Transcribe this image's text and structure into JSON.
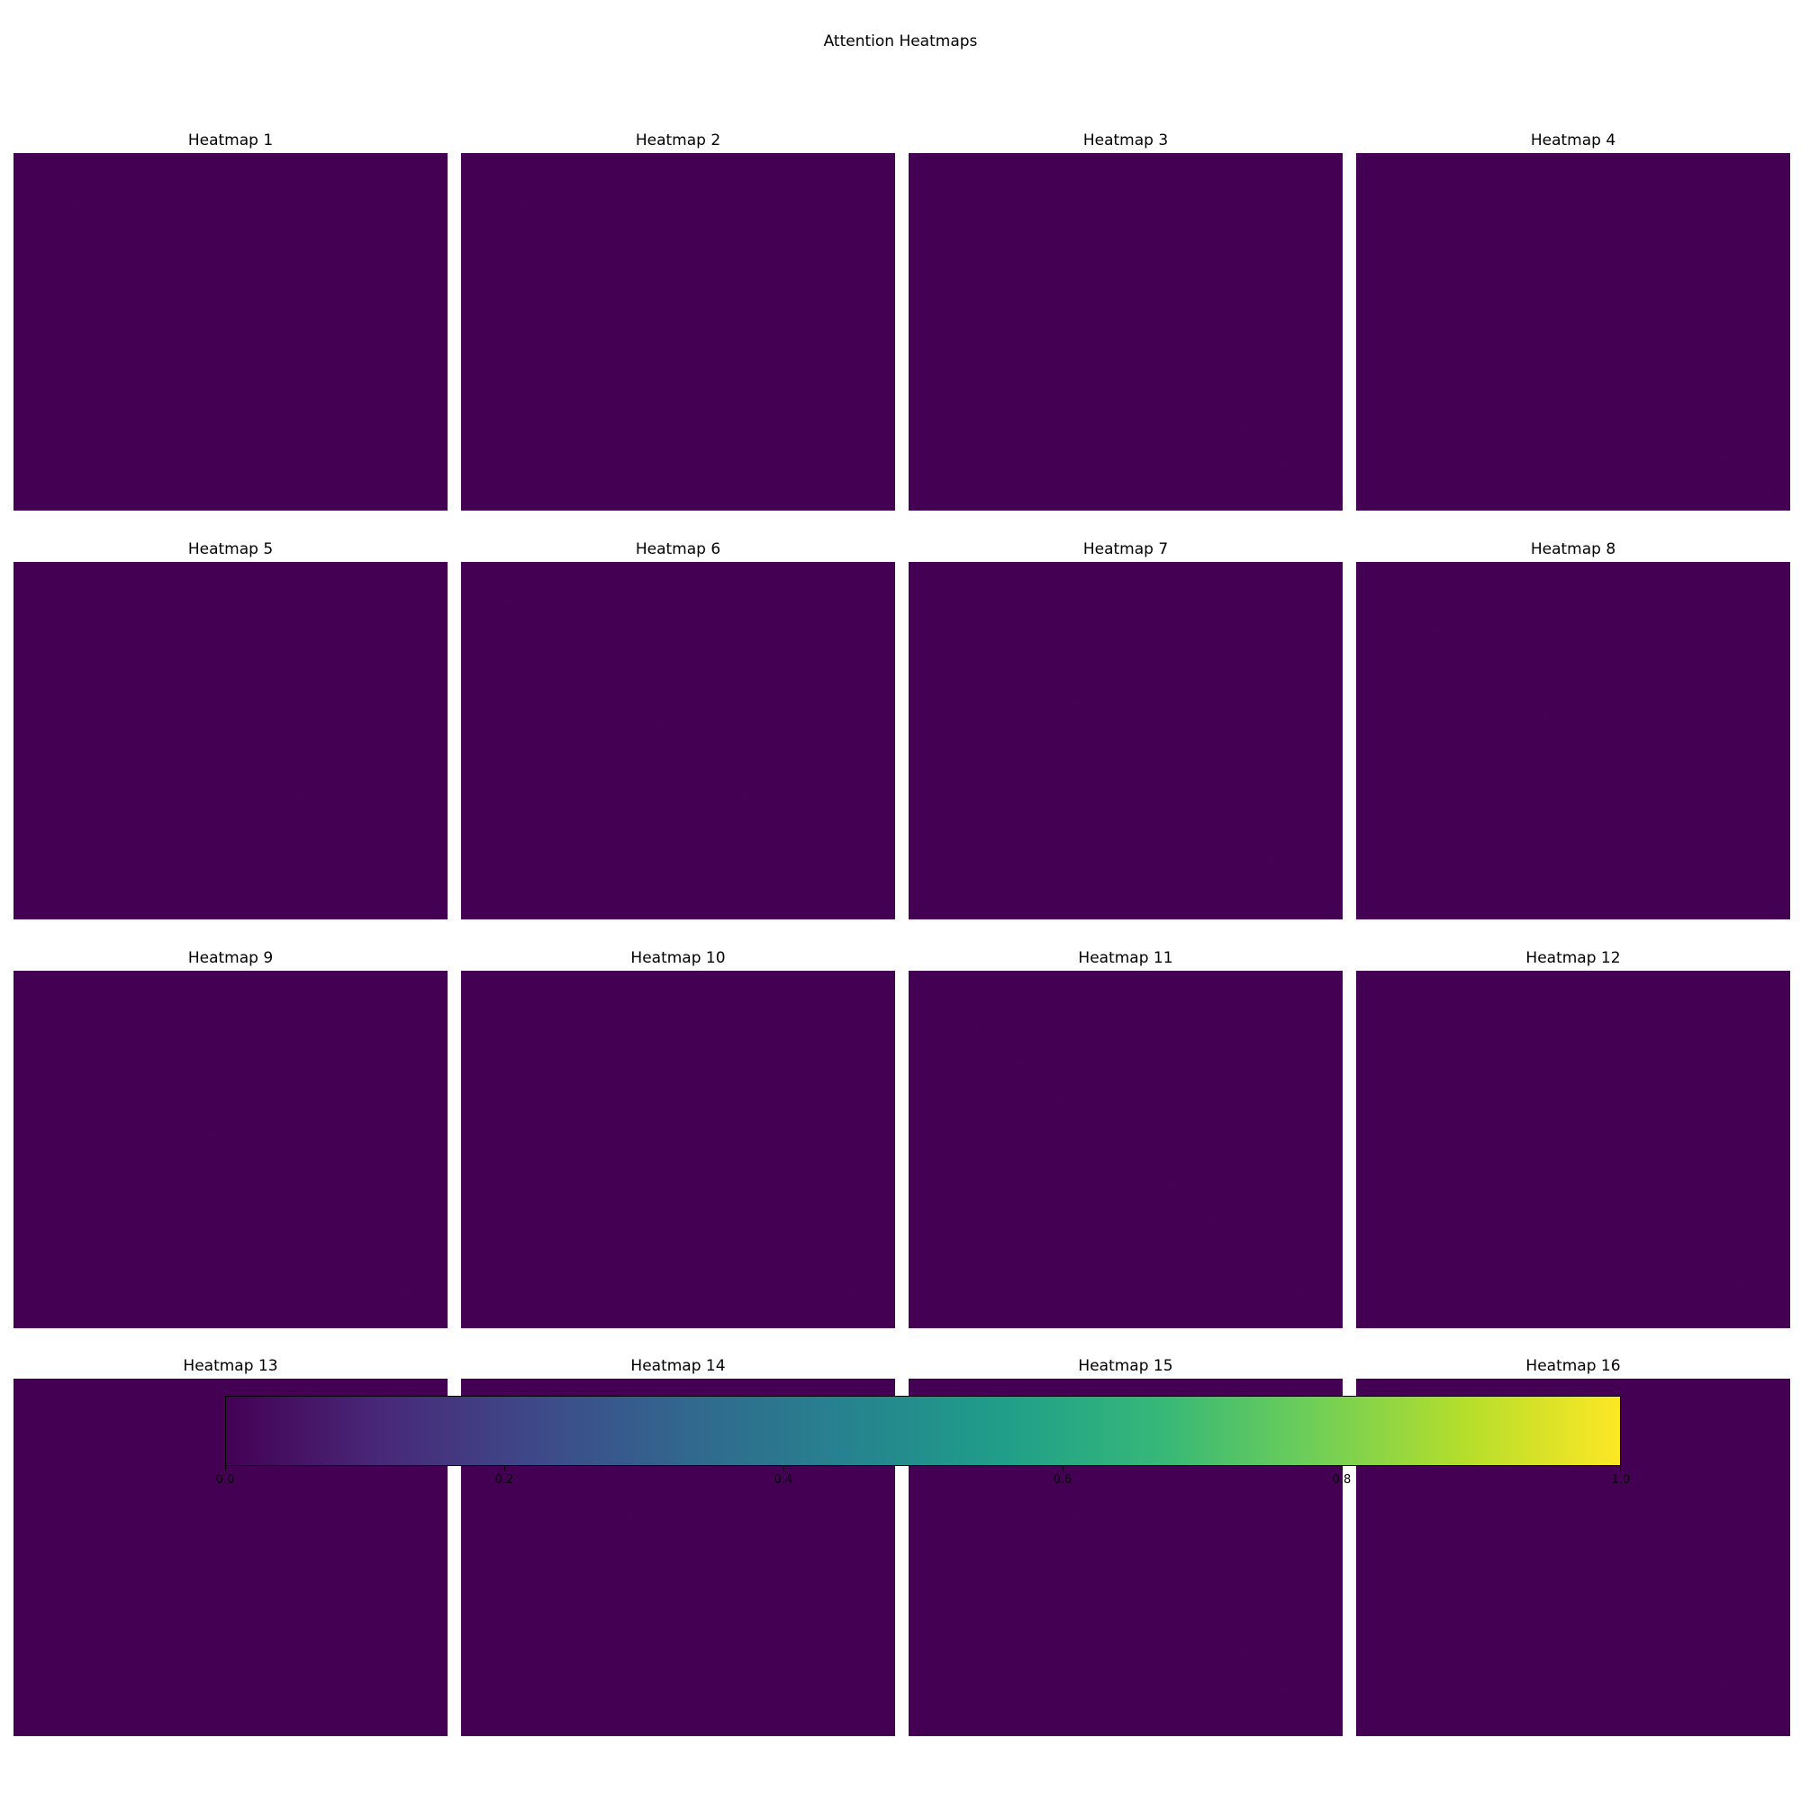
{
  "chart_data": {
    "type": "heatmap",
    "title": "Attention Heatmaps",
    "layout": {
      "rows": 4,
      "columns": 4
    },
    "axes_visible": false,
    "panels": [
      {
        "title": "Heatmap 1",
        "background_value": 0.0,
        "diagonal_value": 0.01
      },
      {
        "title": "Heatmap 2",
        "background_value": 0.0,
        "diagonal_value": 0.01
      },
      {
        "title": "Heatmap 3",
        "background_value": 0.0,
        "diagonal_value": 0.01
      },
      {
        "title": "Heatmap 4",
        "background_value": 0.0,
        "diagonal_value": 0.01
      },
      {
        "title": "Heatmap 5",
        "background_value": 0.0,
        "diagonal_value": 0.01
      },
      {
        "title": "Heatmap 6",
        "background_value": 0.0,
        "diagonal_value": 0.01
      },
      {
        "title": "Heatmap 7",
        "background_value": 0.0,
        "diagonal_value": 0.01
      },
      {
        "title": "Heatmap 8",
        "background_value": 0.0,
        "diagonal_value": 0.01
      },
      {
        "title": "Heatmap 9",
        "background_value": 0.0,
        "diagonal_value": 0.01
      },
      {
        "title": "Heatmap 10",
        "background_value": 0.0,
        "diagonal_value": 0.01
      },
      {
        "title": "Heatmap 11",
        "background_value": 0.0,
        "diagonal_value": 0.01
      },
      {
        "title": "Heatmap 12",
        "background_value": 0.0,
        "diagonal_value": 0.01
      },
      {
        "title": "Heatmap 13",
        "background_value": 0.0,
        "diagonal_value": 0.01
      },
      {
        "title": "Heatmap 14",
        "background_value": 0.0,
        "diagonal_value": 0.01
      },
      {
        "title": "Heatmap 15",
        "background_value": 0.0,
        "diagonal_value": 0.01
      },
      {
        "title": "Heatmap 16",
        "background_value": 0.0,
        "diagonal_value": 0.01
      }
    ],
    "colorbar": {
      "orientation": "horizontal",
      "range": [
        0.0,
        1.0
      ],
      "ticks": [
        0.0,
        0.2,
        0.4,
        0.6,
        0.8,
        1.0
      ],
      "tick_labels": [
        "0.0",
        "0.2",
        "0.4",
        "0.6",
        "0.8",
        "1.0"
      ],
      "colormap": "viridis",
      "colormap_stops": [
        "#440154",
        "#482878",
        "#3e4989",
        "#31688e",
        "#26828e",
        "#1f9e89",
        "#35b779",
        "#6ece58",
        "#b5de2b",
        "#fde725"
      ]
    }
  }
}
